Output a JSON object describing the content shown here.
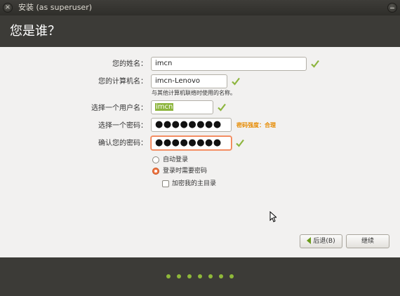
{
  "window": {
    "title": "安装 (as superuser)"
  },
  "page": {
    "title": "您是谁？"
  },
  "form": {
    "name": {
      "label": "您的姓名：",
      "value": "imcn"
    },
    "computer": {
      "label": "您的计算机名：",
      "value": "imcn-Lenovo",
      "hint": "与其他计算机联络时使用的名称。"
    },
    "username": {
      "label": "选择一个用户名：",
      "value": "imcn"
    },
    "password": {
      "label": "选择一个密码：",
      "value": "●●●●●●●●",
      "strength": "密码强度：合理"
    },
    "confirm": {
      "label": "确认您的密码：",
      "value": "●●●●●●●●"
    }
  },
  "options": {
    "auto_login": "自动登录",
    "require_password": "登录时需要密码",
    "encrypt_home": "加密我的主目录",
    "selected": "require_password",
    "encrypt_checked": false
  },
  "buttons": {
    "back": "后退(B)",
    "continue": "继续"
  },
  "progress": {
    "total_steps": 7
  },
  "colors": {
    "header": "#3c3b37",
    "accent": "#f07746",
    "check": "#8db53e",
    "strength": "#e68a00"
  },
  "icons": [
    "close-icon",
    "minimize-icon",
    "checkmark-icon",
    "back-arrow-icon",
    "mouse-pointer-icon"
  ]
}
